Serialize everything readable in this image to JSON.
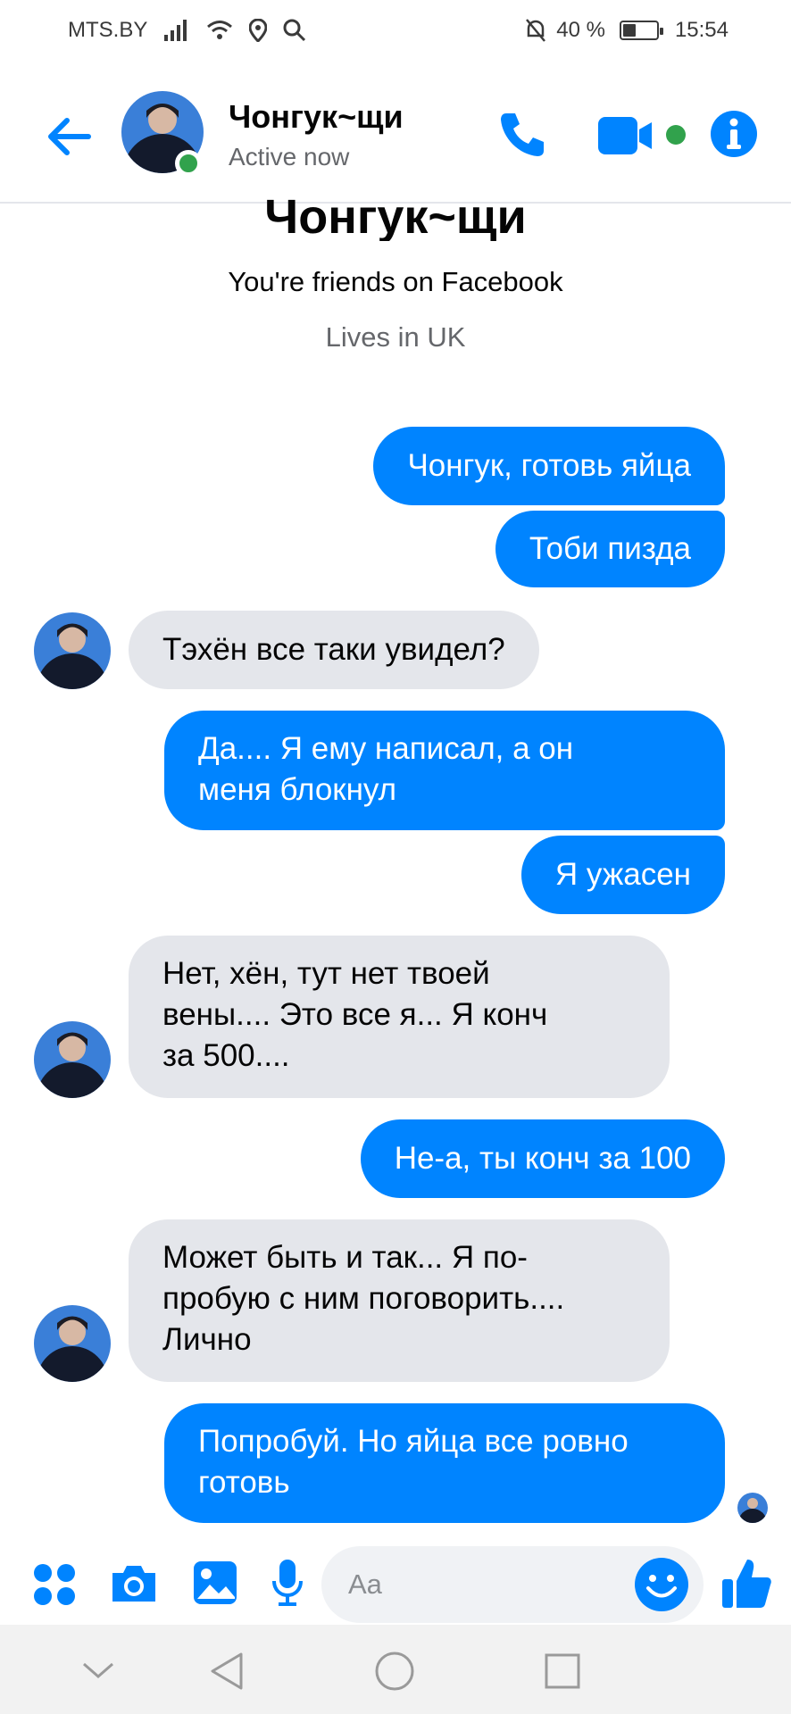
{
  "status_bar": {
    "carrier": "MTS.BY",
    "battery_text": "40 %",
    "battery_level": 0.4,
    "time": "15:54"
  },
  "header": {
    "contact_name": "Чонгук~щи",
    "status": "Active now",
    "icons": [
      "back-arrow-icon",
      "phone-icon",
      "video-camera-icon",
      "info-icon"
    ]
  },
  "intro": {
    "name": "Чонгук~щи",
    "friends": "You're friends on Facebook",
    "lives": "Lives in UK"
  },
  "messages": [
    {
      "direction": "out",
      "text": "Чонгук, готовь яйца"
    },
    {
      "direction": "out",
      "text": "Тоби пизда"
    },
    {
      "direction": "in",
      "text": "Тэхён все таки увидел?"
    },
    {
      "direction": "out",
      "text": "Да.... Я ему написал, а он\nменя блокнул"
    },
    {
      "direction": "out",
      "text": "Я ужасен"
    },
    {
      "direction": "in",
      "text": "Нет, хён, тут нет твоей\nвены.... Это все я... Я конч\nза 500...."
    },
    {
      "direction": "out",
      "text": "Не-а, ты конч за 100"
    },
    {
      "direction": "in",
      "text": "Может быть и так... Я по-\nпробую с ним поговорить....\nЛично"
    },
    {
      "direction": "out",
      "text": "Попробуй. Но яйца все ровно\nготовь"
    }
  ],
  "composer": {
    "placeholder": "Aa",
    "icons": [
      "apps-icon",
      "camera-icon",
      "gallery-icon",
      "microphone-icon",
      "emoji-icon",
      "thumbs-up-icon"
    ]
  },
  "colors": {
    "accent": "#0084ff",
    "online": "#31a24c",
    "incoming_bubble": "#e4e6eb"
  }
}
